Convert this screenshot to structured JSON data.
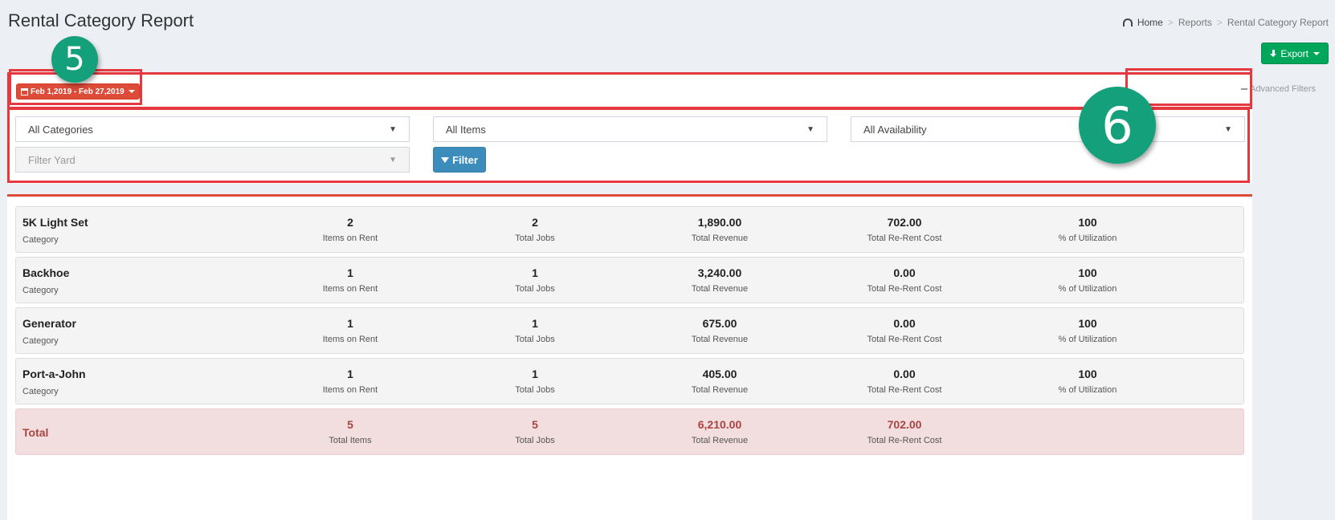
{
  "header": {
    "title": "Rental Category Report",
    "breadcrumb": [
      "Home",
      "Reports",
      "Rental Category Report"
    ],
    "export_label": "Export"
  },
  "filters": {
    "date_range": "Feb 1,2019 - Feb 27,2019",
    "advanced_label": "Advanced Filters",
    "category_select": "All Categories",
    "items_select": "All Items",
    "availability_select": "All Availability",
    "yard_placeholder": "Filter Yard",
    "filter_button": "Filter"
  },
  "annotations": [
    "5",
    "6"
  ],
  "labels": {
    "category": "Category",
    "items_on_rent": "Items on Rent",
    "total_jobs": "Total Jobs",
    "total_revenue": "Total Revenue",
    "re_rent_cost": "Total Re-Rent Cost",
    "utilization": "% of Utilization"
  },
  "rows": [
    {
      "name": "5K Light Set",
      "items": "2",
      "jobs": "2",
      "revenue": "1,890.00",
      "rerent": "702.00",
      "util": "100"
    },
    {
      "name": "Backhoe",
      "items": "1",
      "jobs": "1",
      "revenue": "3,240.00",
      "rerent": "0.00",
      "util": "100"
    },
    {
      "name": "Generator",
      "items": "1",
      "jobs": "1",
      "revenue": "675.00",
      "rerent": "0.00",
      "util": "100"
    },
    {
      "name": "Port-a-John",
      "items": "1",
      "jobs": "1",
      "revenue": "405.00",
      "rerent": "0.00",
      "util": "100"
    }
  ],
  "total": {
    "label": "Total",
    "items": "5",
    "items_label": "Total Items",
    "jobs": "5",
    "jobs_label": "Total Jobs",
    "revenue": "6,210.00",
    "revenue_label": "Total Revenue",
    "rerent": "702.00",
    "rerent_label": "Total Re-Rent Cost"
  },
  "colors": {
    "accent_red": "#dd4b39",
    "export_green": "#00a65a",
    "filter_blue": "#3c8dbc",
    "badge_teal": "#14a07a",
    "annotation_red": "#e5383f"
  }
}
